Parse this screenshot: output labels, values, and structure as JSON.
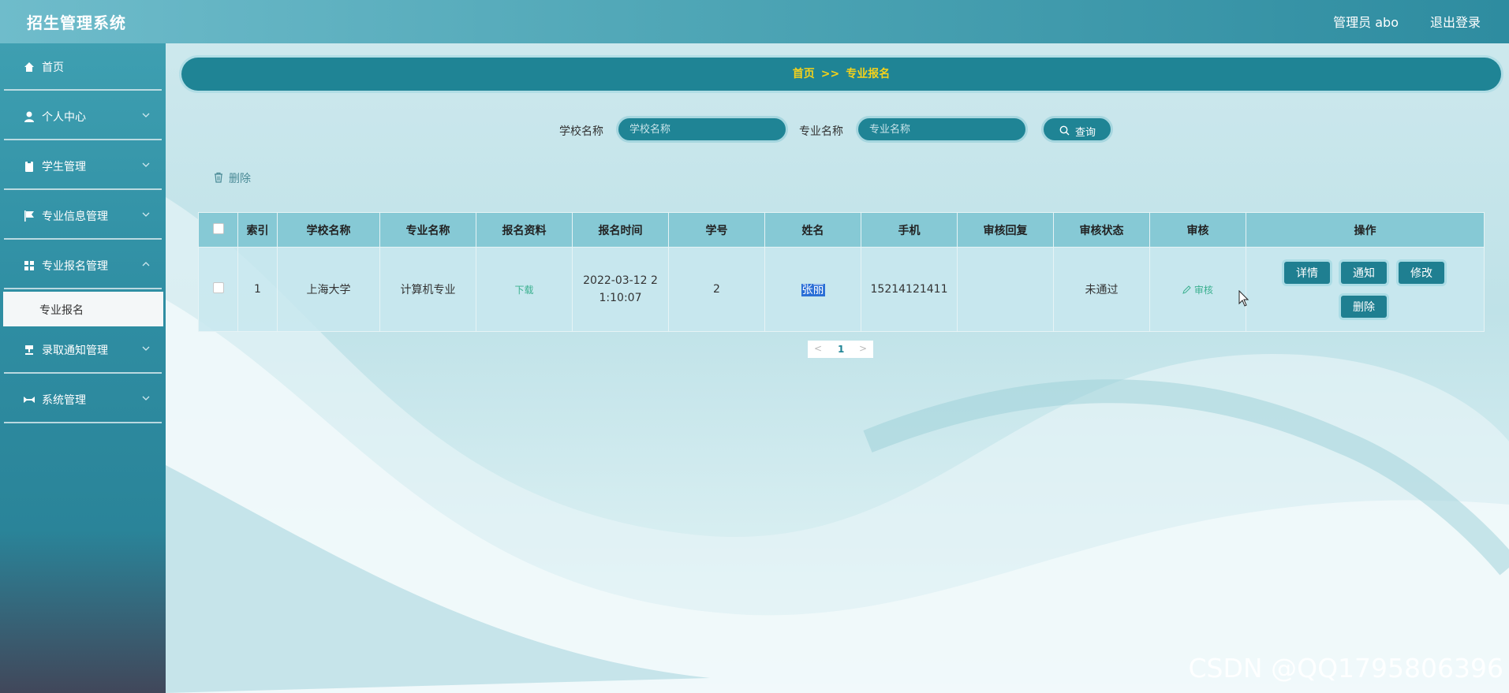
{
  "app": {
    "title": "招生管理系统",
    "admin_label": "管理员 abo",
    "logout": "退出登录"
  },
  "sidebar": {
    "items": [
      {
        "label": "首页",
        "icon": "home-icon"
      },
      {
        "label": "个人中心",
        "icon": "user-icon"
      },
      {
        "label": "学生管理",
        "icon": "clipboard-icon"
      },
      {
        "label": "专业信息管理",
        "icon": "flag-icon"
      },
      {
        "label": "专业报名管理",
        "icon": "grid-icon"
      },
      {
        "label": "录取通知管理",
        "icon": "stamp-icon"
      },
      {
        "label": "系统管理",
        "icon": "settings-icon"
      }
    ],
    "active_sub": "专业报名"
  },
  "breadcrumb": {
    "home": "首页",
    "sep": ">>",
    "current": "专业报名"
  },
  "search": {
    "school_label": "学校名称",
    "school_placeholder": "学校名称",
    "major_label": "专业名称",
    "major_placeholder": "专业名称",
    "button": "查询"
  },
  "toolbar": {
    "delete": "删除"
  },
  "table": {
    "headers": [
      "索引",
      "学校名称",
      "专业名称",
      "报名资料",
      "报名时间",
      "学号",
      "姓名",
      "手机",
      "审核回复",
      "审核状态",
      "审核",
      "操作"
    ],
    "rows": [
      {
        "index": "1",
        "school": "上海大学",
        "major": "计算机专业",
        "material": "下载",
        "time_line1": "2022-03-12 2",
        "time_line2": "1:10:07",
        "student_no": "2",
        "name": "张丽",
        "phone": "15214121411",
        "reply": "",
        "status": "未通过",
        "audit": "审核",
        "ops": {
          "detail": "详情",
          "notify": "通知",
          "edit": "修改",
          "delete": "删除"
        }
      }
    ]
  },
  "pagination": {
    "prev": "<",
    "page": "1",
    "next": ">"
  },
  "watermark": "CSDN @QQ1795806396",
  "colors": {
    "primary": "#1f8495",
    "accent_yellow": "#f5d21a",
    "link_green": "#3bb08f"
  }
}
